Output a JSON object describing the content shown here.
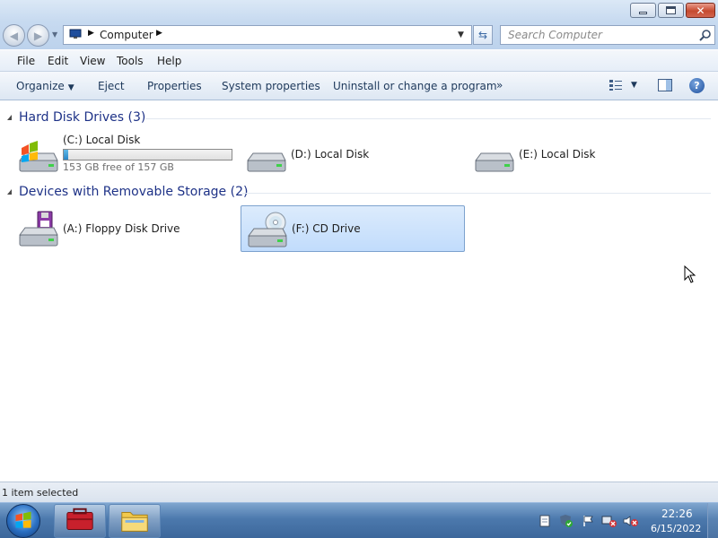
{
  "address": {
    "path": "Computer",
    "search_placeholder": "Search Computer"
  },
  "menu": {
    "file": "File",
    "edit": "Edit",
    "view": "View",
    "tools": "Tools",
    "help": "Help"
  },
  "commands": {
    "organize": "Organize",
    "eject": "Eject",
    "properties": "Properties",
    "system_properties": "System properties",
    "uninstall": "Uninstall or change a program",
    "more": "»"
  },
  "groups": [
    {
      "title": "Hard Disk Drives (3)",
      "items": [
        {
          "label": "(C:) Local Disk",
          "free_text": "153 GB free of 157 GB",
          "used_fraction": 0.025
        },
        {
          "label": "(D:) Local Disk"
        },
        {
          "label": "(E:) Local Disk"
        }
      ]
    },
    {
      "title": "Devices with Removable Storage (2)",
      "items": [
        {
          "label": "(A:) Floppy Disk Drive"
        },
        {
          "label": "(F:) CD Drive",
          "selected": true
        }
      ]
    }
  ],
  "status": {
    "text": "1 item selected"
  },
  "clock": {
    "time": "22:26",
    "date": "6/15/2022"
  },
  "colors": {
    "group_title": "#1e3287",
    "selection": "#c1dcfc",
    "taskbar": "#4c79ad",
    "capacity_fill": "#2a86c6"
  }
}
